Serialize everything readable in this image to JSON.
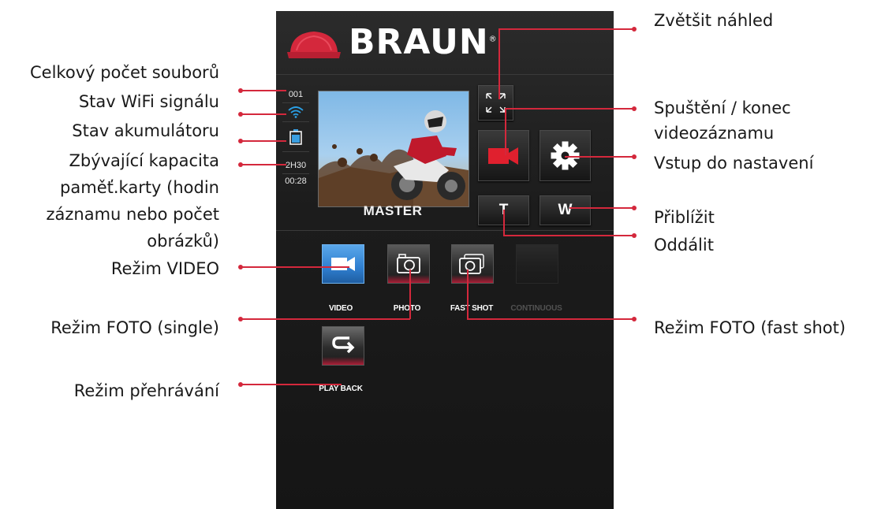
{
  "callouts": {
    "total_files": "Celkový počet souborů",
    "wifi_status": "Stav WiFi signálu",
    "battery_status": "Stav akumulátoru",
    "remaining_l1": "Zbývající kapacita",
    "remaining_l2": "paměť.karty (hodin",
    "remaining_l3": "záznamu nebo počet",
    "remaining_l4": "obrázků)",
    "video_mode": "Režim VIDEO",
    "photo_single": "Režim FOTO (single)",
    "playback_mode": "Režim přehrávání",
    "enlarge_preview": "Zvětšit náhled",
    "record_l1": "Spuštění / konec",
    "record_l2": "videozáznamu",
    "settings_enter": "Vstup do nastavení",
    "zoom_in": "Přiblížit",
    "zoom_out": "Oddálit",
    "photo_fast": "Režim FOTO (fast shot)"
  },
  "app": {
    "brand": "BRAUN",
    "brand_mark": "®",
    "file_count": "001",
    "remaining_capacity": "2H30",
    "recording_time": "00:28",
    "camera_name": "MASTER",
    "tele_label": "T",
    "wide_label": "W",
    "modes": {
      "video": "VIDEO",
      "photo": "PHOTO",
      "fast_shot": "FAST SHOT",
      "continuous": "CONTINUOUS",
      "playback": "PLAY BACK"
    }
  },
  "colors": {
    "accent": "#d4283c",
    "video_tile": "#2f7fd0",
    "wifi_icon": "#2aa0e6",
    "battery_icon": "#3a9ee0"
  },
  "icons": {
    "logo": "braun-cap-logo",
    "wifi": "wifi-icon",
    "battery": "battery-icon",
    "enlarge": "expand-icon",
    "record": "video-camera-icon",
    "settings": "gear-icon",
    "photo": "camera-icon",
    "fast_shot": "burst-camera-icon",
    "playback": "return-arrow-icon"
  }
}
